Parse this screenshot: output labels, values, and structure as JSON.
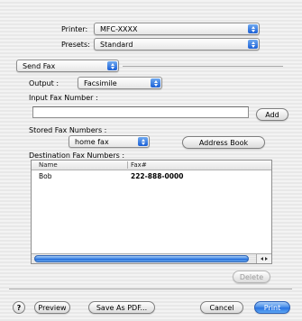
{
  "printer": {
    "label": "Printer:",
    "value": "MFC-XXXX"
  },
  "presets": {
    "label": "Presets:",
    "value": "Standard"
  },
  "panel": {
    "value": "Send Fax"
  },
  "output": {
    "label": "Output :",
    "value": "Facsimile"
  },
  "input_fax": {
    "label": "Input Fax Number :",
    "value": "",
    "add_label": "Add"
  },
  "stored": {
    "label": "Stored Fax Numbers :",
    "value": "home fax",
    "address_book_label": "Address Book"
  },
  "destination": {
    "label": "Destination Fax Numbers :",
    "columns": [
      "Name",
      "Fax#"
    ],
    "rows": [
      {
        "name": "Bob",
        "fax": "222-888-0000"
      }
    ],
    "delete_label": "Delete"
  },
  "footer": {
    "help": "?",
    "preview_label": "Preview",
    "save_pdf_label": "Save As PDF...",
    "cancel_label": "Cancel",
    "print_label": "Print"
  }
}
